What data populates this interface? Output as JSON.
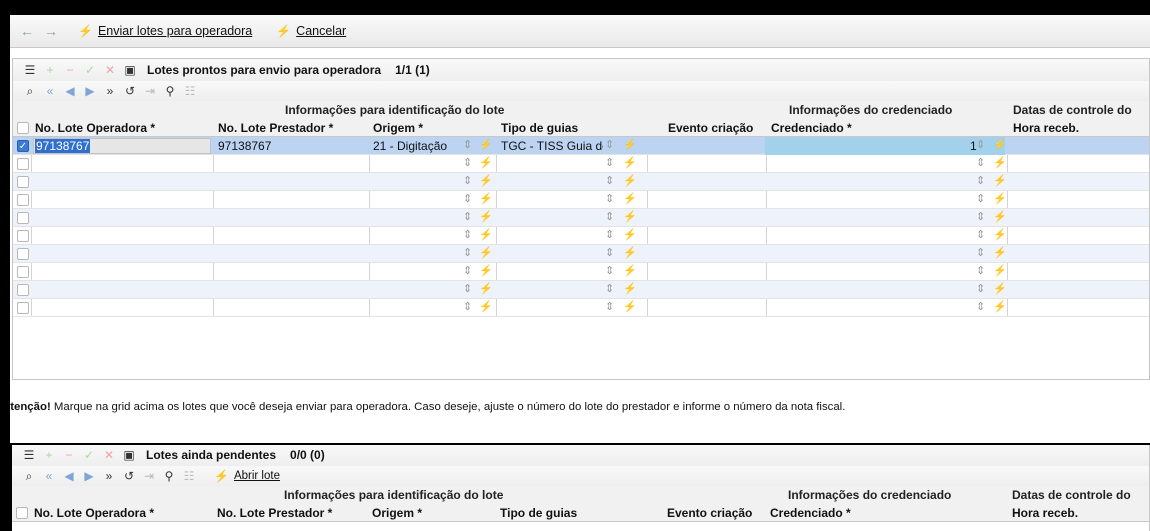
{
  "toolbar": {
    "back_icon": "arrow-left-icon",
    "forward_icon": "arrow-right-icon",
    "send_label": "Enviar lotes para operadora",
    "cancel_label": "Cancelar"
  },
  "panel1": {
    "title": "Lotes prontos para envio para operadora",
    "count": "1/1 (1)",
    "group_headers": [
      "Informações para identificação do lote",
      "Informações do credenciado",
      "Datas de controle do pro"
    ],
    "columns": [
      "No. Lote Operadora *",
      "No. Lote Prestador *",
      "Origem *",
      "Tipo de guias",
      "Evento criação",
      "Credenciado *",
      "Hora receb."
    ],
    "row": {
      "lote_operadora": "97138767",
      "lote_prestador": "97138767",
      "origem": "21 - Digitação",
      "tipo_guias": "TGC - TISS Guia de",
      "credenciado_suffix": "1"
    }
  },
  "attention": {
    "prefix": "Atenção!",
    "text": " Marque na grid acima os lotes que você deseja enviar para operadora. Caso deseje, ajuste o número do lote do prestador e informe o número da nota fiscal."
  },
  "panel2": {
    "title": "Lotes ainda pendentes",
    "count": "0/0 (0)",
    "open_label": "Abrir lote",
    "group_headers": [
      "Informações para identificação do lote",
      "Informações do credenciado",
      "Datas de controle do pro"
    ],
    "columns": [
      "No. Lote Operadora *",
      "No. Lote Prestador *",
      "Origem *",
      "Tipo de guias",
      "Evento criação",
      "Credenciado *",
      "Hora receb."
    ]
  }
}
